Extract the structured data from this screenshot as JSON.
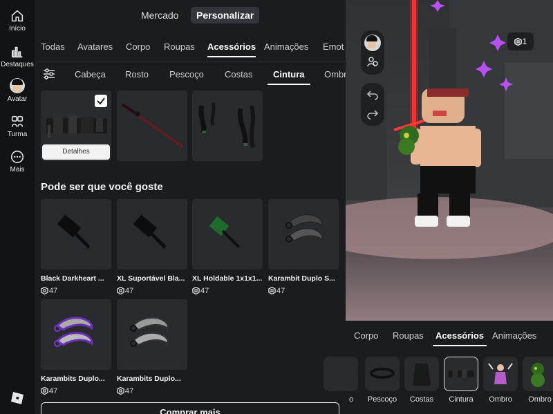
{
  "nav": {
    "items": [
      {
        "label": "Início",
        "icon": "home-icon"
      },
      {
        "label": "Destaques",
        "icon": "chart-icon"
      },
      {
        "label": "Avatar",
        "icon": "avatar-icon"
      },
      {
        "label": "Turma",
        "icon": "group-icon"
      },
      {
        "label": "Mais",
        "icon": "more-icon"
      }
    ]
  },
  "top": {
    "market": "Mercado",
    "customize": "Personalizar"
  },
  "tabs": [
    "Todas",
    "Avatares",
    "Corpo",
    "Roupas",
    "Acessórios",
    "Animações",
    "Emot"
  ],
  "active_tab": "Acessórios",
  "subtabs": [
    "Cabeça",
    "Rosto",
    "Pescoço",
    "Costas",
    "Cintura",
    "Ombr"
  ],
  "active_subtab": "Cintura",
  "equipped": {
    "details_label": "Detalhes"
  },
  "section_title": "Pode ser que você goste",
  "recommendations": [
    {
      "name": "Black Darkheart ...",
      "price": "47"
    },
    {
      "name": "XL Suportável Bla...",
      "price": "47"
    },
    {
      "name": "XL Holdable 1x1x1...",
      "price": "47"
    },
    {
      "name": "Karambit Duplo S...",
      "price": "47"
    },
    {
      "name": "Karambits Duplo...",
      "price": "47"
    },
    {
      "name": "Karambits Duplo...",
      "price": "47"
    }
  ],
  "more_button": "Comprar mais",
  "robux_balance": "1",
  "bottom_tabs": [
    "Corpo",
    "Roupas",
    "Acessórios",
    "Animações"
  ],
  "bottom_active": "Acessórios",
  "slots": [
    "o",
    "Pescoço",
    "Costas",
    "Cintura",
    "Ombro",
    "Ombro"
  ],
  "colors": {
    "bg": "#1b1c1f",
    "nav": "#121316",
    "card": "#2a2b2f",
    "saber": "#ff2a2a",
    "purple_spark": "#b84ff0"
  }
}
